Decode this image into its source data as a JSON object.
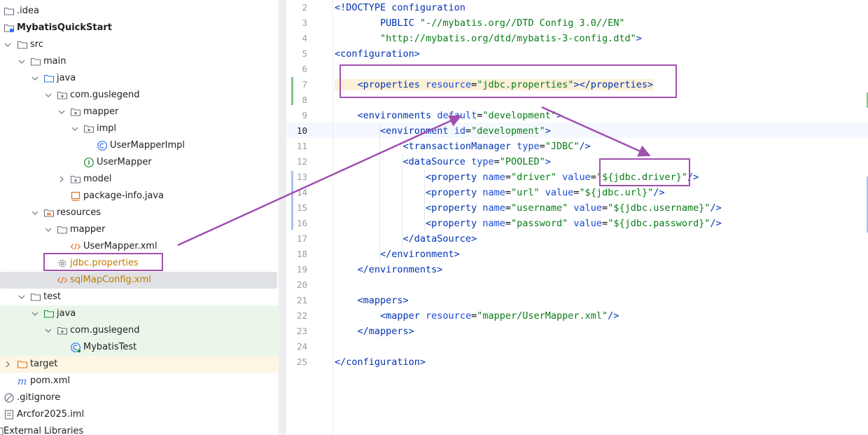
{
  "project_tree": {
    "items": [
      {
        "label": "MybatisQuickStart"
      },
      {
        "label": ".idea"
      },
      {
        "label": "src"
      },
      {
        "label": "main"
      },
      {
        "label": "java"
      },
      {
        "label": "com.guslegend"
      },
      {
        "label": "mapper"
      },
      {
        "label": "impl"
      },
      {
        "label": "UserMapperImpl"
      },
      {
        "label": "UserMapper"
      },
      {
        "label": "model"
      },
      {
        "label": "package-info.java"
      },
      {
        "label": "resources"
      },
      {
        "label": "mapper"
      },
      {
        "label": "UserMapper.xml"
      },
      {
        "label": "jdbc.properties"
      },
      {
        "label": "sqlMapConfig.xml"
      },
      {
        "label": "test"
      },
      {
        "label": "java"
      },
      {
        "label": "com.guslegend"
      },
      {
        "label": "MybatisTest"
      },
      {
        "label": "target"
      },
      {
        "label": "pom.xml"
      },
      {
        "label": ".gitignore"
      },
      {
        "label": "Arcfor2025.iml"
      },
      {
        "label": "External Libraries"
      }
    ]
  },
  "editor": {
    "line_numbers": [
      "2",
      "3",
      "4",
      "5",
      "6",
      "7",
      "8",
      "9",
      "10",
      "11",
      "12",
      "13",
      "14",
      "15",
      "16",
      "17",
      "18",
      "19",
      "20",
      "21",
      "22",
      "23",
      "24",
      "25"
    ],
    "lines": {
      "l2_a": "<!DOCTYPE configuration",
      "l3_a": "        PUBLIC ",
      "l3_b": "\"-//mybatis.org//DTD Config 3.0//EN\"",
      "l4_a": "        ",
      "l4_b": "\"http://mybatis.org/dtd/mybatis-3-config.dtd\"",
      "l4_c": ">",
      "l5_a": "<configuration>",
      "l7_a": "    <properties ",
      "l7_b": "resource",
      "l7_c": "=",
      "l7_d": "\"jdbc.properties\"",
      "l7_e": "></properties>",
      "l9_a": "    <environments ",
      "l9_b": "default",
      "l9_c": "=",
      "l9_d": "\"development\"",
      "l9_e": ">",
      "l10_a": "        <environment ",
      "l10_b": "id",
      "l10_c": "=",
      "l10_d": "\"development\"",
      "l10_e": ">",
      "l11_a": "            <transactionManager ",
      "l11_b": "type",
      "l11_c": "=",
      "l11_d": "\"JDBC\"",
      "l11_e": "/>",
      "l12_a": "            <dataSource ",
      "l12_b": "type",
      "l12_c": "=",
      "l12_d": "\"POOLED\"",
      "l12_e": ">",
      "l13_a": "                <property ",
      "l13_b": "name",
      "l13_c": "=",
      "l13_d": "\"driver\"",
      "l13_e": " value",
      "l13_f": "=",
      "l13_g": "\"${jdbc.driver}\"",
      "l13_h": "/>",
      "l14_a": "                <property ",
      "l14_b": "name",
      "l14_c": "=",
      "l14_d": "\"url\"",
      "l14_e": " value",
      "l14_f": "=",
      "l14_g": "\"${jdbc.url}\"",
      "l14_h": "/>",
      "l15_a": "                <property ",
      "l15_b": "name",
      "l15_c": "=",
      "l15_d": "\"username\"",
      "l15_e": " value",
      "l15_f": "=",
      "l15_g": "\"${jdbc.username}\"",
      "l15_h": "/>",
      "l16_a": "                <property ",
      "l16_b": "name",
      "l16_c": "=",
      "l16_d": "\"password\"",
      "l16_e": " value",
      "l16_f": "=",
      "l16_g": "\"${jdbc.password}\"",
      "l16_h": "/>",
      "l17_a": "            </dataSource>",
      "l18_a": "        </environment>",
      "l19_a": "    </environments>",
      "l21_a": "    <mappers>",
      "l22_a": "        <mapper ",
      "l22_b": "resource",
      "l22_c": "=",
      "l22_d": "\"mapper/UserMapper.xml\"",
      "l22_e": "/>",
      "l23_a": "    </mappers>",
      "l25_a": "</configuration>"
    }
  },
  "colors": {
    "annotation": "#a14fb0",
    "selection_row": "#dfe1e5",
    "test_bg": "#eaf6ea",
    "target_bg": "#fdf6e3"
  },
  "icons": [
    "folder-icon",
    "module-icon",
    "package-icon",
    "class-icon",
    "interface-icon",
    "java-file-icon",
    "resources-folder-icon",
    "xml-icon",
    "properties-icon",
    "test-class-icon",
    "maven-icon",
    "ignore-icon",
    "iml-icon",
    "chevron-right-icon",
    "chevron-down-icon"
  ]
}
